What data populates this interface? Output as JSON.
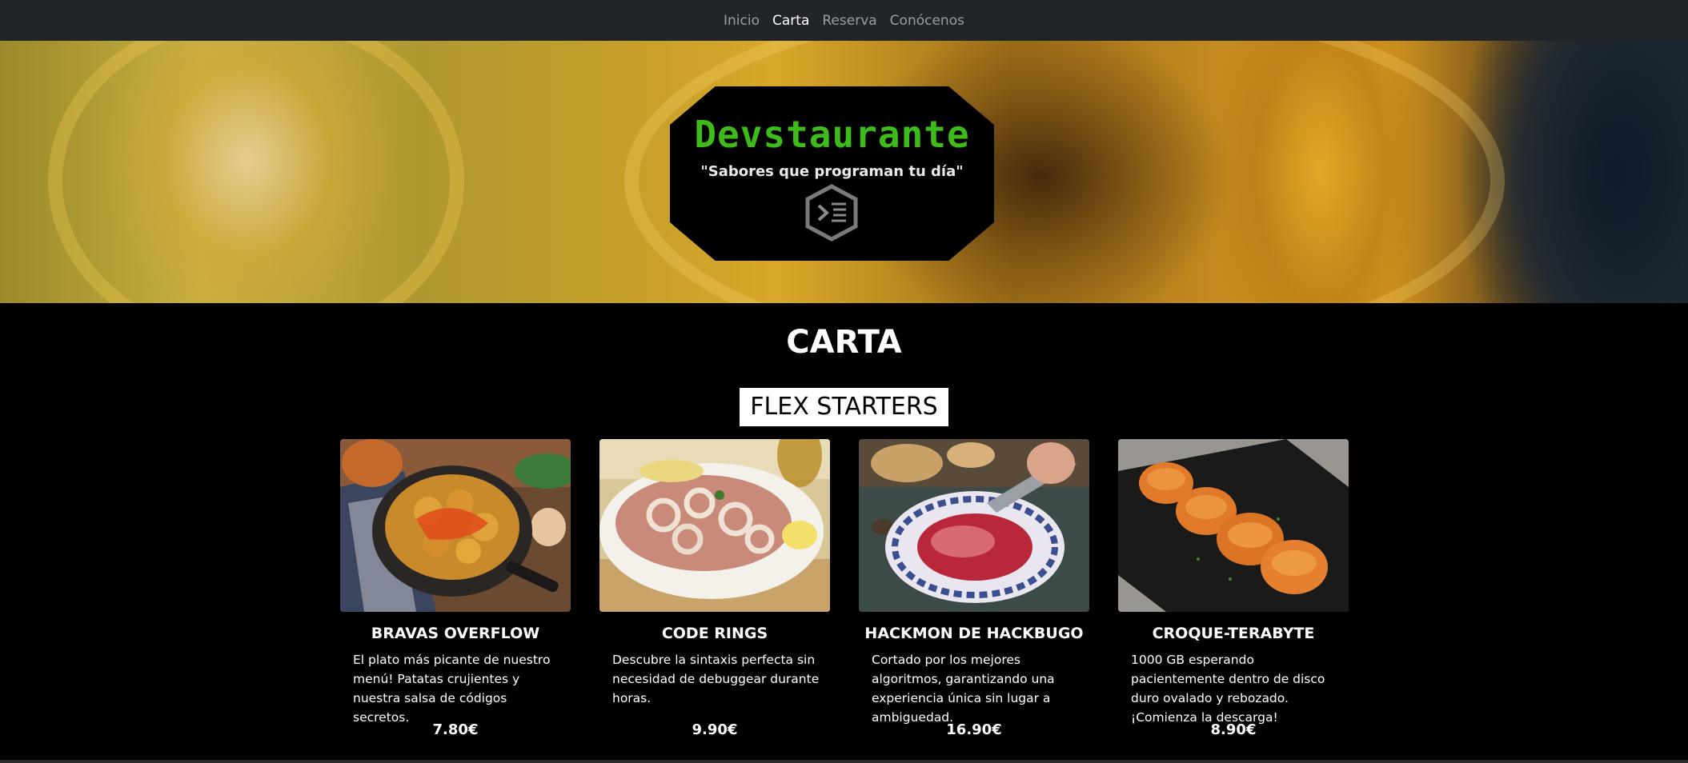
{
  "nav": {
    "items": [
      {
        "label": "Inicio",
        "active": false
      },
      {
        "label": "Carta",
        "active": true
      },
      {
        "label": "Reserva",
        "active": false
      },
      {
        "label": "Conócenos",
        "active": false
      }
    ]
  },
  "hero": {
    "brand": "Devstaurante",
    "tagline": "\"Sabores que programan tu día\"",
    "logo_icon": "terminal-hexagon-icon"
  },
  "menu": {
    "title": "CARTA",
    "category": "FLEX STARTERS",
    "items": [
      {
        "title": "BRAVAS OVERFLOW",
        "description": "El plato más picante de nuestro menú! Patatas crujientes y nuestra salsa de códigos secretos.",
        "price": "7.80€",
        "image": "patatas-bravas-photo"
      },
      {
        "title": "CODE RINGS",
        "description": "Descubre la sintaxis perfecta sin necesidad de debuggear durante horas.",
        "price": "9.90€",
        "image": "calamari-rings-photo"
      },
      {
        "title": "HACKMON DE HACKBUGO",
        "description": "Cortado por los mejores algoritmos, garantizando una experiencia única sin lugar a ambiguedad.",
        "price": "16.90€",
        "image": "jamon-plate-photo"
      },
      {
        "title": "CROQUE-TERABYTE",
        "description": "1000 GB esperando pacientemente dentro de disco duro ovalado y rebozado. ¡Comienza la descarga!",
        "price": "8.90€",
        "image": "croquetas-photo"
      }
    ]
  },
  "colors": {
    "navbar": "#212529",
    "brand_green": "#3dbb1b",
    "background": "#000000"
  }
}
